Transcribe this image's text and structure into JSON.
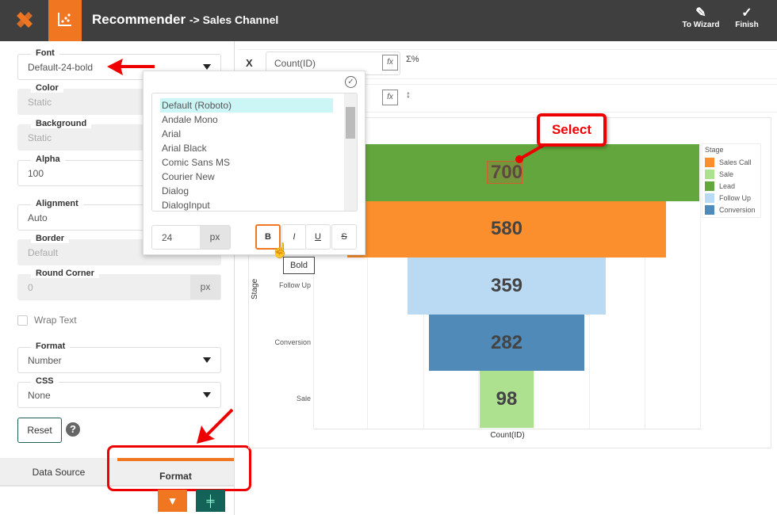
{
  "header": {
    "title": "Recommender",
    "subtitle": "-> Sales Channel",
    "to_wizard": "To Wizard",
    "finish": "Finish",
    "accent": "#f07622"
  },
  "format_panel": {
    "font": {
      "label": "Font",
      "value": "Default-24-bold"
    },
    "color": {
      "label": "Color",
      "value": "Static"
    },
    "background": {
      "label": "Background",
      "value": "Static"
    },
    "alpha": {
      "label": "Alpha",
      "value": "100"
    },
    "alignment": {
      "label": "Alignment",
      "value": "Auto"
    },
    "border": {
      "label": "Border",
      "value": "Default"
    },
    "round_corner": {
      "label": "Round Corner",
      "value": "0",
      "unit": "px"
    },
    "wrap_text": {
      "label": "Wrap Text",
      "checked": false
    },
    "format": {
      "label": "Format",
      "value": "Number"
    },
    "css": {
      "label": "CSS",
      "value": "None"
    },
    "reset": "Reset"
  },
  "tabs": [
    {
      "label": "Data Source",
      "active": false
    },
    {
      "label": "Format",
      "active": true
    }
  ],
  "font_popup": {
    "fonts": [
      "Default (Roboto)",
      "Andale Mono",
      "Arial",
      "Arial Black",
      "Comic Sans MS",
      "Courier New",
      "Dialog",
      "DialogInput"
    ],
    "selected": "Default (Roboto)",
    "size": "24",
    "size_unit": "px",
    "bold": "B",
    "italic": "I",
    "underline": "U",
    "strike": "S",
    "tooltip": "Bold"
  },
  "binding": {
    "x_label": "X",
    "x_field": "Count(ID)"
  },
  "annotation": {
    "callout": "Select"
  },
  "chart_data": {
    "type": "funnel",
    "categories": [
      "Lead",
      "Sales Call",
      "Follow Up",
      "Conversion",
      "Sale"
    ],
    "values": [
      700,
      580,
      359,
      282,
      98
    ],
    "colors": [
      "#62a63d",
      "#fb8f2d",
      "#b9daf2",
      "#4f8ab8",
      "#ade08f"
    ],
    "xlabel": "Count(ID)",
    "ylabel": "Stage",
    "legend": {
      "title": "Stage",
      "placement": "right",
      "entries": [
        {
          "name": "Sales Call",
          "color": "#fb8f2d"
        },
        {
          "name": "Sale",
          "color": "#ade08f"
        },
        {
          "name": "Lead",
          "color": "#62a63d"
        },
        {
          "name": "Follow Up",
          "color": "#b9daf2"
        },
        {
          "name": "Conversion",
          "color": "#4f8ab8"
        }
      ]
    }
  }
}
